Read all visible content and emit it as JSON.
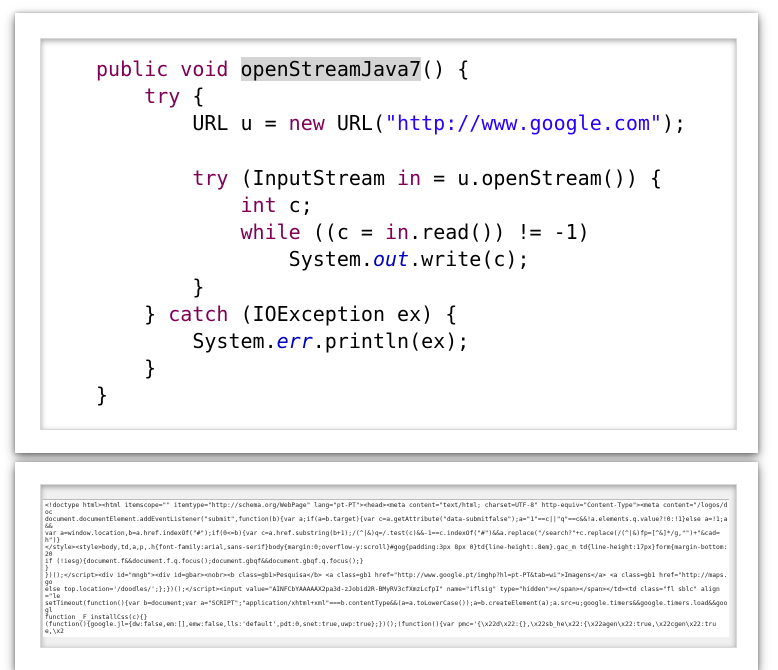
{
  "code_panel": {
    "colors": {
      "keyword": "#7f0055",
      "string": "#2a00ff",
      "field": "#0000c0",
      "highlight": "#d4d4d4"
    },
    "lines": [
      [
        {
          "t": "public void ",
          "c": "kw"
        },
        {
          "t": "openStreamJava7",
          "c": "hl"
        },
        {
          "t": "() {",
          "c": ""
        }
      ],
      [
        {
          "t": "    ",
          "c": ""
        },
        {
          "t": "try",
          "c": "kw"
        },
        {
          "t": " {",
          "c": ""
        }
      ],
      [
        {
          "t": "        URL u = ",
          "c": ""
        },
        {
          "t": "new",
          "c": "kw"
        },
        {
          "t": " URL(",
          "c": ""
        },
        {
          "t": "\"http://www.google.com\"",
          "c": "str"
        },
        {
          "t": ");",
          "c": ""
        }
      ],
      [],
      [
        {
          "t": "        ",
          "c": ""
        },
        {
          "t": "try",
          "c": "kw"
        },
        {
          "t": " (InputStream ",
          "c": ""
        },
        {
          "t": "in",
          "c": "kw"
        },
        {
          "t": " = u.openStream()) {",
          "c": ""
        }
      ],
      [
        {
          "t": "            ",
          "c": ""
        },
        {
          "t": "int",
          "c": "kw"
        },
        {
          "t": " c;",
          "c": ""
        }
      ],
      [
        {
          "t": "            ",
          "c": ""
        },
        {
          "t": "while",
          "c": "kw"
        },
        {
          "t": " ((c = ",
          "c": ""
        },
        {
          "t": "in",
          "c": "kw"
        },
        {
          "t": ".read()) != -1)",
          "c": ""
        }
      ],
      [
        {
          "t": "                System.",
          "c": ""
        },
        {
          "t": "out",
          "c": "fld"
        },
        {
          "t": ".write(c);",
          "c": ""
        }
      ],
      [
        {
          "t": "        }",
          "c": ""
        }
      ],
      [
        {
          "t": "    } ",
          "c": ""
        },
        {
          "t": "catch",
          "c": "kw"
        },
        {
          "t": " (IOException ex) {",
          "c": ""
        }
      ],
      [
        {
          "t": "        System.",
          "c": ""
        },
        {
          "t": "err",
          "c": "fld"
        },
        {
          "t": ".println(ex);",
          "c": ""
        }
      ],
      [
        {
          "t": "    }",
          "c": ""
        }
      ],
      [
        {
          "t": "}",
          "c": ""
        }
      ]
    ]
  },
  "output_panel": {
    "lines": [
      "<!doctype html><html itemscope=\"\" itemtype=\"http://schema.org/WebPage\" lang=\"pt-PT\"><head><meta content=\"text/html; charset=UTF-8\" http-equiv=\"Content-Type\"><meta content=\"/logos/doc",
      "document.documentElement.addEventListener(\"submit\",function(b){var a;if(a=b.target){var c=a.getAttribute(\"data-submitfalse\");a=\"1\"==c||\"q\"==c&&!a.elements.q.value?!0:!1}else a=!1;a&&",
      "var a=window.location,b=a.href.indexOf(\"#\");if(0<=b){var c=a.href.substring(b+1);/(^|&)q=/.test(c)&&-1==c.indexOf(\"#\")&&a.replace(\"/search?\"+c.replace(/(^|&)fp=[^&]*/g,\"\")+\"&cad=h\")}",
      "</style><style>body,td,a,p,.h{font-family:arial,sans-serif}body{margin:0;overflow-y:scroll}#gog{padding:3px 8px 0}td{line-height:.8em}.gac_m td{line-height:17px}form{margin-bottom:20",
      "if (!iesg){document.f&&document.f.q.focus();document.gbqf&&document.gbqf.q.focus();}",
      "}",
      "})();</script><div id=\"mngb\"><div id=gbar><nobr><b class=gb1>Pesquisa</b> <a class=gb1 href=\"http://www.google.pt/imghp?hl=pt-PT&tab=wi\">Imagens</a> <a class=gb1 href=\"http://maps.go",
      "else top.location='/doodles/';};})();</script><input value=\"AINFCbYAAAAAX2pa3d-zJobid2R-BMyRV3cfXmzLcfpI\" name=\"iflsig\" type=\"hidden\"></span></span></td><td class=\"fl sblc\" align=\"le",
      "setTimeout(function(){var b=document;var a=\"SCRIPT\";\"application/xhtml+xml\"===b.contentType&&(a=a.toLowerCase());a=b.createElement(a);a.src=u;google.timers&&google.timers.load&&googl",
      "function _F_installCss(c){}",
      "(function(){google.jl={dw:false,em:[],emw:false,lls:'default',pdt:0,snet:true,uwp:true};})();(function(){var pmc='{\\x22d\\x22:{},\\x22sb_he\\x22:{\\x22agen\\x22:true,\\x22cgen\\x22:true,\\x2"
    ]
  }
}
